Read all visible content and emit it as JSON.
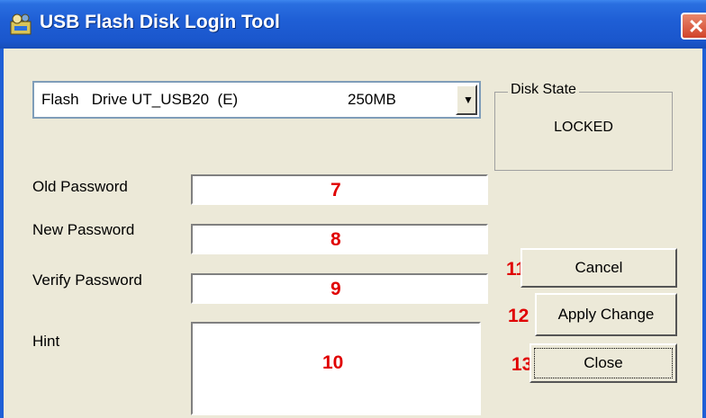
{
  "window": {
    "title": "USB Flash Disk Login Tool",
    "close_glyph": "✕"
  },
  "drive_select": {
    "selected_name": "Flash   Drive UT_USB20  (E)",
    "selected_size": "250MB",
    "arrow_glyph": "▼"
  },
  "disk_state": {
    "legend": "Disk State",
    "value": "LOCKED"
  },
  "fields": {
    "old_password": {
      "label": "Old Password",
      "marker": "7"
    },
    "new_password": {
      "label": "New Password",
      "marker": "8"
    },
    "verify_password": {
      "label": "Verify Password",
      "marker": "9"
    },
    "hint": {
      "label": "Hint",
      "marker": "10"
    }
  },
  "buttons": {
    "cancel": {
      "label": "Cancel",
      "marker": "11"
    },
    "apply": {
      "label": "Apply Change",
      "marker": "12"
    },
    "close": {
      "label": "Close",
      "marker": "13"
    }
  },
  "colors": {
    "titlebar": "#1f5fd6",
    "dialog": "#ece9d8",
    "marker": "#e00000"
  },
  "icons": {
    "app": "usb-drive-icon",
    "close": "close-icon"
  }
}
